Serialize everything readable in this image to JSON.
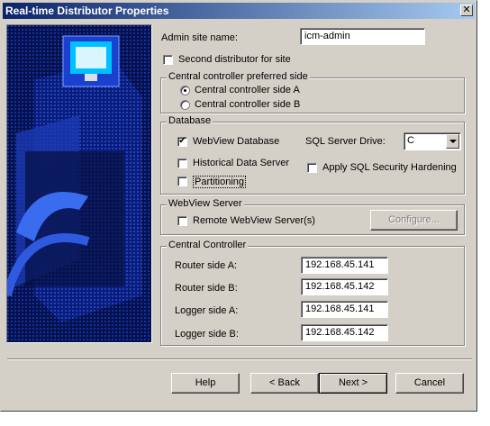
{
  "window": {
    "title": "Real-time Distributor Properties",
    "close_glyph": "✕"
  },
  "admin_site": {
    "label": "Admin site name:",
    "value": "icm-admin"
  },
  "second_distributor": {
    "label": "Second distributor for site",
    "checked": false
  },
  "preferred_side": {
    "title": "Central controller preferred side",
    "options": [
      {
        "label": "Central controller side A",
        "selected": true
      },
      {
        "label": "Central controller side B",
        "selected": false
      }
    ]
  },
  "database": {
    "title": "Database",
    "webview_db": {
      "label": "WebView Database",
      "checked": true
    },
    "historical": {
      "label": "Historical Data Server",
      "checked": false
    },
    "partitioning": {
      "label": "Partitioning",
      "checked": false
    },
    "sql_drive": {
      "label": "SQL Server Drive:",
      "value": "C"
    },
    "sql_hardening": {
      "label": "Apply SQL Security Hardening",
      "checked": false
    }
  },
  "webview_server": {
    "title": "WebView Server",
    "remote": {
      "label": "Remote WebView Server(s)",
      "checked": false
    },
    "configure_label": "Configure..."
  },
  "central_controller": {
    "title": "Central Controller",
    "router_a": {
      "label": "Router side A:",
      "value": "192.168.45.141"
    },
    "router_b": {
      "label": "Router side B:",
      "value": "192.168.45.142"
    },
    "logger_a": {
      "label": "Logger side A:",
      "value": "192.168.45.141"
    },
    "logger_b": {
      "label": "Logger side B:",
      "value": "192.168.45.142"
    }
  },
  "buttons": {
    "help": "Help",
    "back": "< Back",
    "next": "Next >",
    "cancel": "Cancel"
  },
  "figure_id": "228095",
  "colors": {
    "title_start": "#0a246a",
    "title_end": "#a6caf0",
    "face": "#d4d0c8",
    "art_bg": "#000f5a"
  },
  "icons": {
    "art": "computer-network-illustration",
    "check": "✔"
  }
}
